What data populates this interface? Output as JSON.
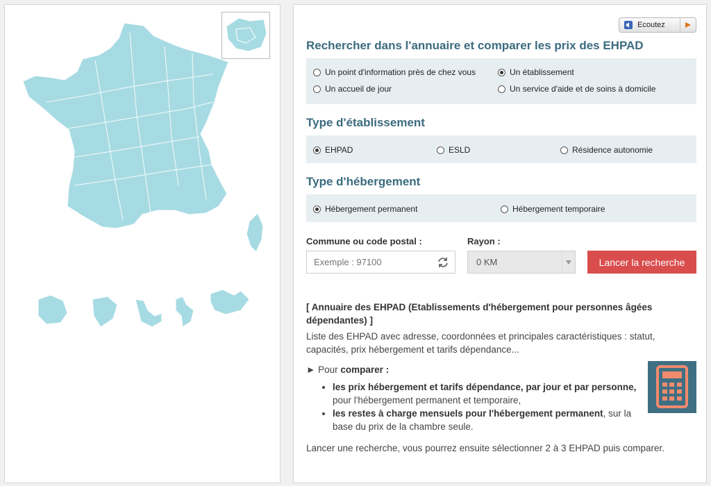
{
  "header": {
    "listen_label": "Ecoutez"
  },
  "colors": {
    "map_fill": "#a7dbe3",
    "title": "#3b6b7f",
    "accent_button": "#d94d4d",
    "option_bg": "#e7eef1",
    "calculator_bg": "#3f6f83",
    "calculator_keys": "#f08b6e"
  },
  "search": {
    "title": "Rechercher dans l'annuaire et comparer les prix des EHPAD",
    "options": [
      {
        "label": "Un point d'information près de chez vous",
        "selected": false
      },
      {
        "label": "Un établissement",
        "selected": true
      },
      {
        "label": "Un accueil de jour",
        "selected": false
      },
      {
        "label": "Un service d'aide et de soins à domicile",
        "selected": false
      }
    ]
  },
  "etablissement": {
    "title": "Type d'établissement",
    "options": [
      {
        "label": "EHPAD",
        "selected": true
      },
      {
        "label": "ESLD",
        "selected": false
      },
      {
        "label": "Résidence autonomie",
        "selected": false
      }
    ]
  },
  "hebergement": {
    "title": "Type d'hébergement",
    "options": [
      {
        "label": "Hébergement permanent",
        "selected": true
      },
      {
        "label": "Hébergement temporaire",
        "selected": false
      }
    ]
  },
  "form": {
    "commune_label": "Commune ou code postal :",
    "commune_placeholder": "Exemple : 97100",
    "rayon_label": "Rayon :",
    "rayon_value": "0 KM",
    "submit_label": "Lancer la recherche"
  },
  "info": {
    "heading": "[ Annuaire des EHPAD (Etablissements d'hébergement pour personnes âgées dépendantes) ]",
    "description": "Liste des EHPAD avec adresse, coordonnées et principales caractéristiques : statut, capacités, prix hébergement et tarifs dépendance...",
    "compare_prefix": "► Pour ",
    "compare_bold": "comparer :",
    "bullet1_bold": "les prix hébergement et tarifs dépendance, par jour et par personne,",
    "bullet1_rest": " pour l'hébergement permanent et temporaire,",
    "bullet2_bold": "les restes à charge mensuels pour l'hébergement permanent",
    "bullet2_rest": ", sur la base du prix de la chambre seule.",
    "footer": "Lancer une recherche, vous pourrez ensuite sélectionner 2 à 3 EHPAD puis comparer."
  }
}
